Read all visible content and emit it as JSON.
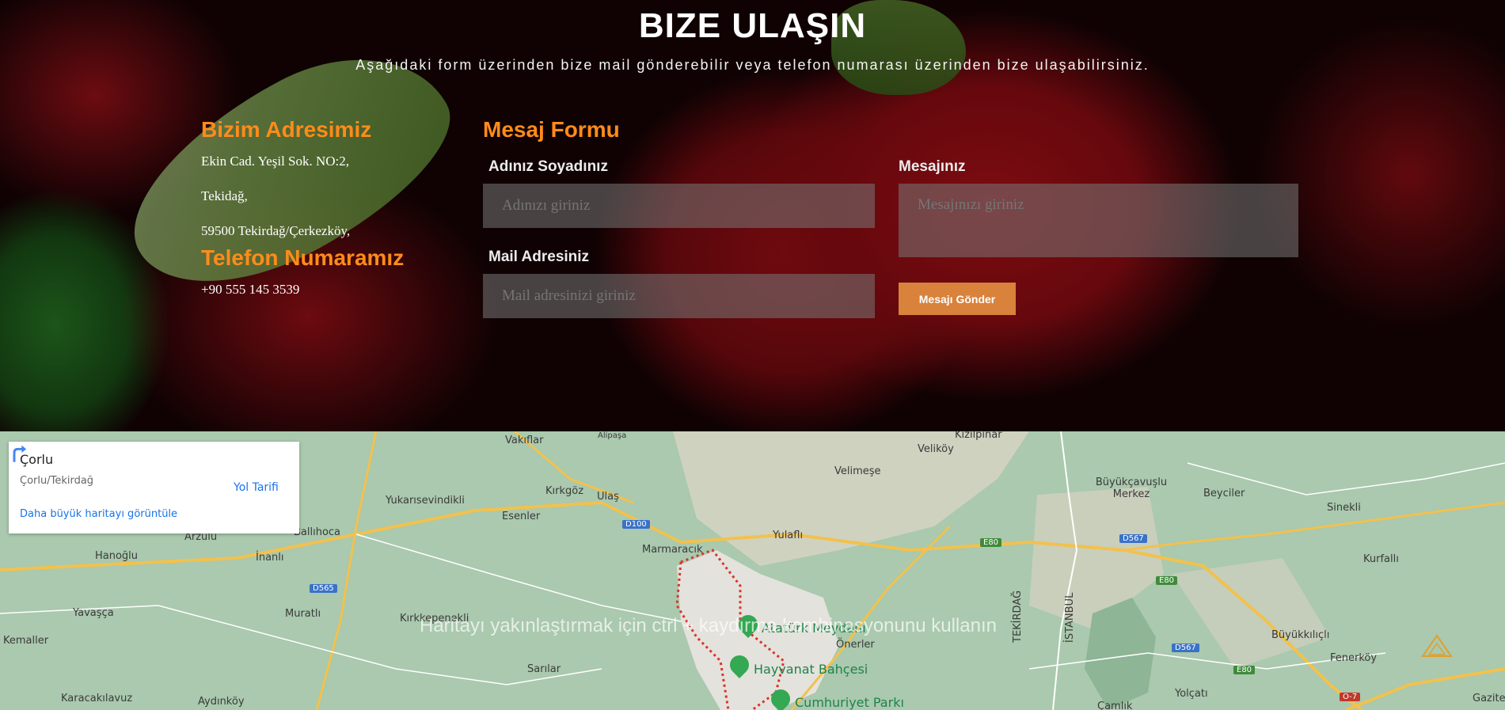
{
  "hero": {
    "title": "BIZE ULAŞIN",
    "subtitle": "Aşağıdaki form üzerinden bize mail gönderebilir veya telefon numarası üzerinden bize ulaşabilirsiniz."
  },
  "address": {
    "heading": "Bizim Adresimiz",
    "lines": [
      "Ekin Cad. Yeşil Sok. NO:2,",
      "Tekidağ,",
      "59500 Tekirdağ/Çerkezköy,"
    ],
    "phone_heading": "Telefon Numaramız",
    "phone": "+90 555 145 3539"
  },
  "form": {
    "heading": "Mesaj Formu",
    "name_label": "Adınız Soyadınız",
    "name_placeholder": "Adınızı giriniz",
    "mail_label": "Mail Adresiniz",
    "mail_placeholder": "Mail adresinizi giriniz",
    "message_label": "Mesajınız",
    "message_placeholder": "Mesajınızı giriniz",
    "submit_label": "Mesajı Gönder"
  },
  "map": {
    "info_title": "Çorlu",
    "info_subtitle": "Çorlu/Tekirdağ",
    "directions_label": "Yol Tarifi",
    "larger_map_link": "Daha büyük haritayı görüntüle",
    "zoom_hint": "Haritayı yakınlaştırmak için ctrl + kaydırma kombinasyonunu kullanın",
    "places": [
      "Vakıflar",
      "Alipaşa",
      "Kızılpınar",
      "Veliköy",
      "Velimeşe",
      "Büyükçavuşlu Merkez",
      "Beyciler",
      "Sinekli",
      "Yukarısevindikli",
      "Kırkgöz",
      "Ulaş",
      "Esenler",
      "Ballıhoca",
      "Arzulu",
      "Hanoğlu",
      "İnanlı",
      "Marmaracık",
      "Yulaflı",
      "Kurfallı",
      "Yavaşça",
      "Muratlı",
      "Kırkkepenekli",
      "Önerler",
      "Büyükkılıçlı",
      "Fenerköy",
      "Kemaller",
      "Sarılar",
      "Yolçatı",
      "Karacakılavuz",
      "Aydınköy",
      "Çamlık",
      "Gazitepe",
      "TEKİRDAĞ",
      "İSTANBUL"
    ],
    "pois": [
      "Atatürk Meydanı",
      "Hayvanat Bahçesi",
      "Cumhuriyet Parkı"
    ],
    "road_shields": [
      "D100",
      "E80",
      "D567",
      "E80",
      "D565",
      "D567",
      "E80",
      "O-7"
    ]
  }
}
